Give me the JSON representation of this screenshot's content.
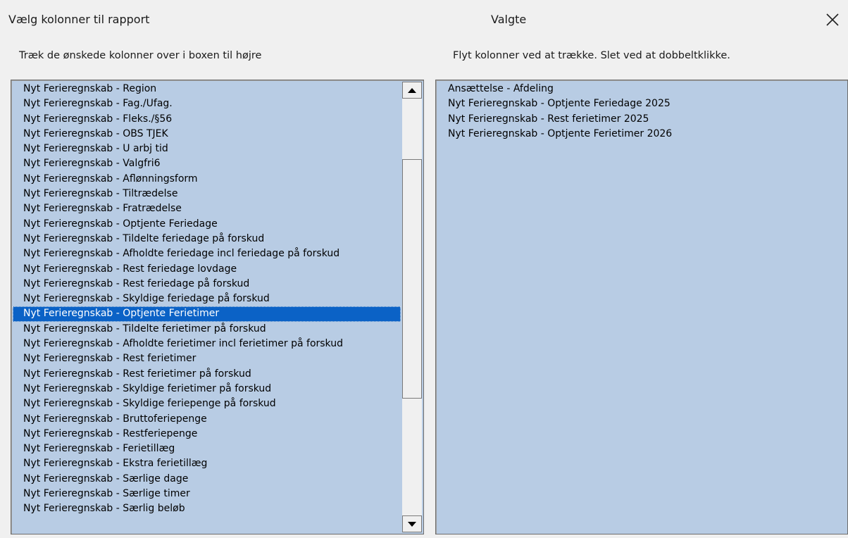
{
  "header": {
    "title_left": "Vælg kolonner til rapport",
    "title_right": "Valgte",
    "close_icon": "close-icon"
  },
  "left_panel": {
    "hint": "Træk de ønskede kolonner over i boxen til højre",
    "selected_index": 15,
    "items": [
      "Nyt Ferieregnskab - Region",
      "Nyt Ferieregnskab - Fag./Ufag.",
      "Nyt Ferieregnskab - Fleks./§56",
      "Nyt Ferieregnskab - OBS TJEK",
      "Nyt Ferieregnskab - U arbj tid",
      "Nyt Ferieregnskab - Valgfri6",
      "Nyt Ferieregnskab - Aflønningsform",
      "Nyt Ferieregnskab - Tiltrædelse",
      "Nyt Ferieregnskab - Fratrædelse",
      "Nyt Ferieregnskab - Optjente Feriedage",
      "Nyt Ferieregnskab - Tildelte feriedage på forskud",
      "Nyt Ferieregnskab - Afholdte feriedage incl feriedage på forskud",
      "Nyt Ferieregnskab - Rest feriedage lovdage",
      "Nyt Ferieregnskab - Rest feriedage på forskud",
      "Nyt Ferieregnskab - Skyldige feriedage på forskud",
      "Nyt Ferieregnskab - Optjente Ferietimer",
      "Nyt Ferieregnskab - Tildelte ferietimer på forskud",
      "Nyt Ferieregnskab - Afholdte ferietimer incl ferietimer på forskud",
      "Nyt Ferieregnskab - Rest ferietimer",
      "Nyt Ferieregnskab - Rest ferietimer på forskud",
      "Nyt Ferieregnskab - Skyldige ferietimer på forskud",
      "Nyt Ferieregnskab - Skyldige feriepenge på forskud",
      "Nyt Ferieregnskab - Bruttoferiepenge",
      "Nyt Ferieregnskab - Restferiepenge",
      "Nyt Ferieregnskab - Ferietillæg",
      "Nyt Ferieregnskab - Ekstra ferietillæg",
      "Nyt Ferieregnskab - Særlige dage",
      "Nyt Ferieregnskab - Særlige timer",
      "Nyt Ferieregnskab - Særlig beløb"
    ]
  },
  "right_panel": {
    "hint": "Flyt kolonner ved at trække. Slet ved at dobbeltklikke.",
    "items": [
      "Ansættelse - Afdeling",
      "Nyt Ferieregnskab - Optjente Feriedage 2025",
      "Nyt Ferieregnskab - Rest ferietimer 2025",
      "Nyt Ferieregnskab - Optjente Ferietimer 2026"
    ]
  },
  "colors": {
    "list_background": "#b8cce4",
    "selection": "#0b62c6",
    "window_background": "#f0f0f0"
  }
}
